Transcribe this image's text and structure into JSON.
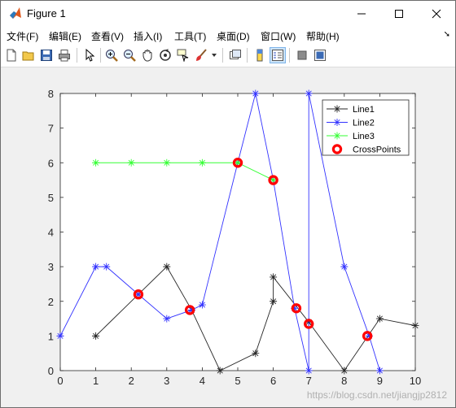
{
  "window": {
    "title": "Figure 1"
  },
  "menu": {
    "items": [
      "文件(F)",
      "编辑(E)",
      "查看(V)",
      "插入(I)",
      "工具(T)",
      "桌面(D)",
      "窗口(W)",
      "帮助(H)"
    ]
  },
  "toolbar": {
    "icons": [
      "new-figure-icon",
      "open-file-icon",
      "save-icon",
      "print-icon",
      "pointer-icon",
      "zoom-in-icon",
      "zoom-out-icon",
      "pan-icon",
      "rotate-3d-icon",
      "data-cursor-icon",
      "brush-icon",
      "brush-dropdown-icon",
      "link-plot-icon",
      "colorbar-icon",
      "legend-icon",
      "hide-plot-tools-icon",
      "show-plot-tools-icon"
    ]
  },
  "watermark": "https://blog.csdn.net/jiangjp2812",
  "colors": {
    "line1": "#262626",
    "line2": "#3232ff",
    "line3": "#33ff33",
    "cross": "#ff0000"
  },
  "chart_data": {
    "type": "line",
    "xlim": [
      0,
      10
    ],
    "ylim": [
      0,
      8
    ],
    "x_ticks": [
      "0",
      "1",
      "2",
      "3",
      "4",
      "5",
      "6",
      "7",
      "8",
      "9",
      "10"
    ],
    "y_ticks": [
      "0",
      "1",
      "2",
      "3",
      "4",
      "5",
      "6",
      "7",
      "8"
    ],
    "grid": false,
    "legend_position": "top-right",
    "series": [
      {
        "name": "Line1",
        "marker": "*",
        "color": "#262626",
        "x": [
          1,
          2.2,
          3,
          3.7,
          4.5,
          5.5,
          6,
          6,
          7,
          8,
          9,
          10
        ],
        "y": [
          1,
          2.2,
          3,
          1.75,
          0,
          0.5,
          2,
          2.7,
          1.4,
          0,
          1.5,
          1.3
        ]
      },
      {
        "name": "Line2",
        "marker": "*",
        "color": "#3232ff",
        "x": [
          0,
          1,
          1.3,
          2.2,
          3,
          3.7,
          4,
          5,
          5.5,
          6,
          6.6,
          7,
          7,
          8,
          8.7,
          9
        ],
        "y": [
          1,
          3,
          3,
          2.2,
          1.5,
          1.75,
          1.9,
          6,
          8,
          5.5,
          1.8,
          0,
          8,
          3,
          1,
          0
        ]
      },
      {
        "name": "Line3",
        "marker": "*",
        "color": "#33ff33",
        "x": [
          1,
          2,
          3,
          4,
          5,
          6
        ],
        "y": [
          6,
          6,
          6,
          6,
          6,
          5.5
        ]
      },
      {
        "name": "CrossPoints",
        "marker": "o",
        "color": "#ff0000",
        "x": [
          2.2,
          3.65,
          5,
          6,
          6.65,
          7,
          8.65
        ],
        "y": [
          2.2,
          1.75,
          6,
          5.5,
          1.8,
          1.35,
          1
        ]
      }
    ]
  }
}
